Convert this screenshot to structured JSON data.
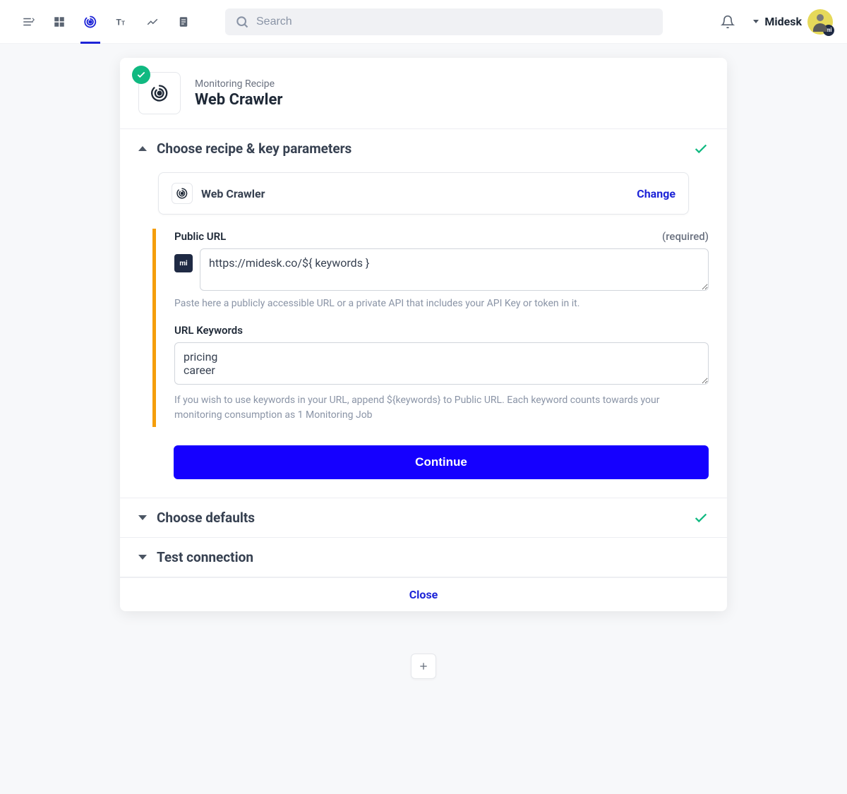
{
  "topbar": {
    "search_placeholder": "Search",
    "account_name": "Midesk",
    "avatar_badge": "mi"
  },
  "card": {
    "header": {
      "subtitle": "Monitoring Recipe",
      "title": "Web Crawler"
    },
    "section1": {
      "title": "Choose recipe & key parameters",
      "recipe_name": "Web Crawler",
      "change_label": "Change",
      "public_url_label": "Public URL",
      "required_label": "(required)",
      "public_url_value": "https://midesk.co/${ keywords }",
      "public_url_helper": "Paste here a publicly accessible URL or a private API that includes your API Key or token in it.",
      "keywords_label": "URL Keywords",
      "keywords_value": "pricing\ncareer",
      "keywords_helper": "If you wish to use keywords in your URL, append ${keywords} to Public URL. Each keyword counts towards your monitoring consumption as 1 Monitoring Job",
      "continue_label": "Continue"
    },
    "section2": {
      "title": "Choose defaults"
    },
    "section3": {
      "title": "Test connection"
    },
    "footer": {
      "close_label": "Close"
    }
  },
  "mi_chip": "mi"
}
